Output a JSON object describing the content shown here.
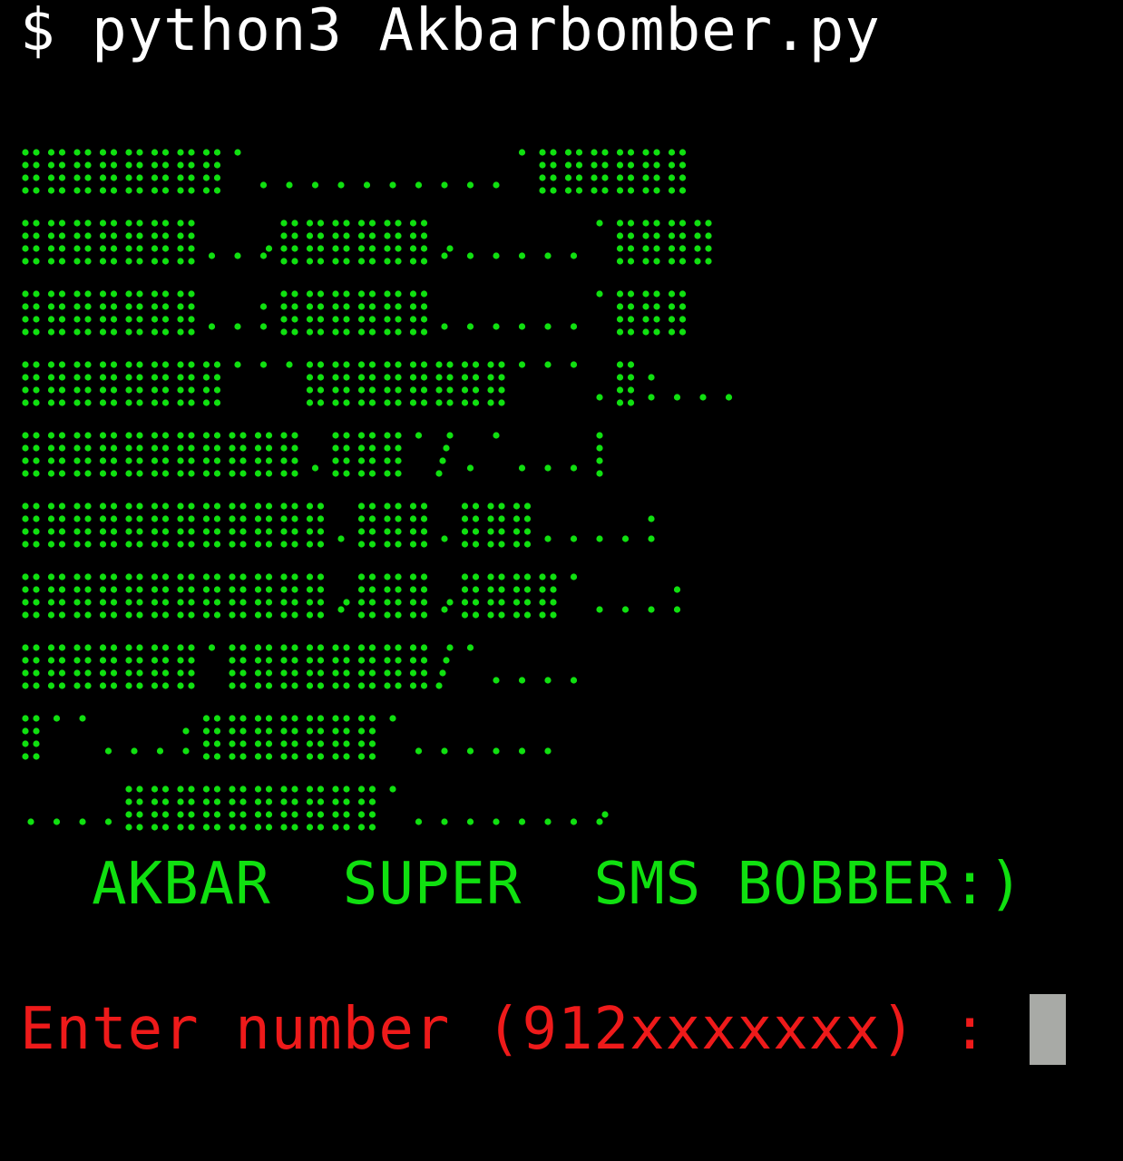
{
  "terminal": {
    "command_line": "$ python3 Akbarbomber.py",
    "banner_color": "#10e010",
    "title": "  AKBAR  SUPER  SMS BOBBER:)",
    "input_prompt": "Enter number (912xxxxxxx) : ",
    "prompt_color": "#ee1a1a",
    "cursor_color": "#a8aaa6",
    "banner_art": [
      "########'..........'######",
      "#######..,######,.....'####",
      "#######..:######......'###",
      "########'''########'''.#:......",
      "###########.###'/.'...|",
      "############.###.###....:",
      "############,###,####'...:",
      "#######'########/'....",
      "#''...:#######'......",
      "....##########'.......,"
    ]
  }
}
